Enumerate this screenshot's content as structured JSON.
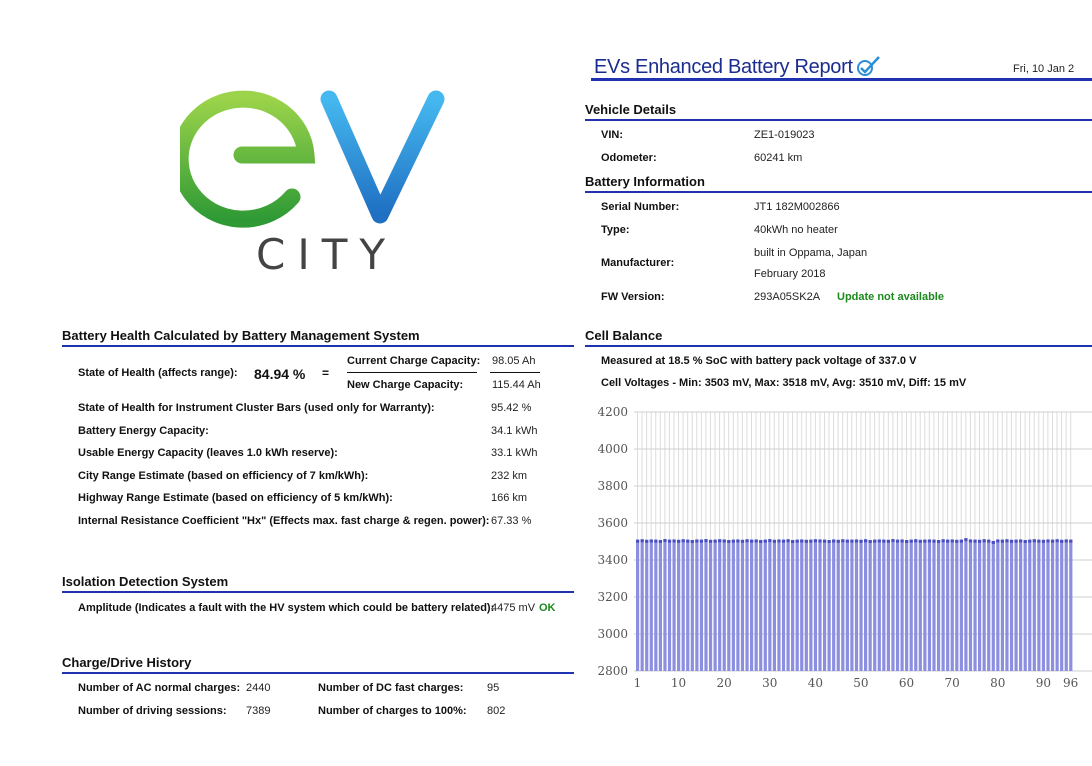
{
  "logo": {
    "city_text": "CITY"
  },
  "report": {
    "title": "EVs Enhanced Battery Report",
    "date": "Fri, 10 Jan 2"
  },
  "vehicle": {
    "section_title": "Vehicle Details",
    "vin_label": "VIN:",
    "vin": "ZE1-019023",
    "odometer_label": "Odometer:",
    "odometer": "60241 km"
  },
  "battery": {
    "section_title": "Battery Information",
    "serial_label": "Serial Number:",
    "serial": "JT1 182M002866",
    "type_label": "Type:",
    "type": "40kWh no heater",
    "manufacturer_label": "Manufacturer:",
    "manufacturer_line1": "built in Oppama, Japan",
    "manufacturer_line2": "February 2018",
    "fw_label": "FW Version:",
    "fw": "293A05SK2A",
    "fw_status": "Update not available"
  },
  "health": {
    "section_title": "Battery Health Calculated by Battery Management System",
    "soh_label": "State of Health (affects range):",
    "soh_value": "84.94 %",
    "equals": "=",
    "current_cap_label": "Current Charge Capacity:",
    "current_cap": "98.05 Ah",
    "new_cap_label": "New Charge Capacity:",
    "new_cap": "115.44 Ah",
    "rows": [
      {
        "label": "State of Health for Instrument Cluster Bars (used only for Warranty):",
        "value": "95.42 %"
      },
      {
        "label": "Battery Energy Capacity:",
        "value": "34.1 kWh"
      },
      {
        "label": "Usable Energy Capacity (leaves 1.0 kWh reserve):",
        "value": "33.1 kWh"
      },
      {
        "label": "City Range Estimate (based on efficiency of 7 km/kWh):",
        "value": "232 km"
      },
      {
        "label": "Highway Range Estimate (based on efficiency of 5 km/kWh):",
        "value": "166 km"
      },
      {
        "label": "Internal Resistance Coefficient \"Hx\" (Effects max. fast charge & regen. power):",
        "value": "67.33 %"
      }
    ]
  },
  "isolation": {
    "section_title": "Isolation Detection System",
    "amplitude_label": "Amplitude (Indicates a fault with the HV system which could be battery related):",
    "amplitude": "4475 mV",
    "status": "OK"
  },
  "history": {
    "section_title": "Charge/Drive History",
    "ac_label": "Number of AC normal charges:",
    "ac": "2440",
    "dc_label": "Number of DC fast charges:",
    "dc": "95",
    "sessions_label": "Number of driving sessions:",
    "sessions": "7389",
    "full_label": "Number of charges to 100%:",
    "full": "802"
  },
  "cell_balance": {
    "section_title": "Cell Balance",
    "measured": "Measured at 18.5 % SoC with battery pack voltage of 337.0 V",
    "voltages": "Cell Voltages - Min: 3503 mV, Max: 3518 mV, Avg: 3510 mV, Diff: 15 mV"
  },
  "colors": {
    "accent": "#1f33b0",
    "ok": "#1c8a1c",
    "bar": "#8c8fe0",
    "bar_edge": "#4a4ec0"
  },
  "chart_data": {
    "type": "bar",
    "title": "",
    "xlabel": "",
    "ylabel": "",
    "ylim": [
      2800,
      4200
    ],
    "yticks": [
      2800,
      3000,
      3200,
      3400,
      3600,
      3800,
      4000,
      4200
    ],
    "xticks": [
      1,
      10,
      20,
      30,
      40,
      50,
      60,
      70,
      80,
      90,
      96
    ],
    "x": [
      1,
      2,
      3,
      4,
      5,
      6,
      7,
      8,
      9,
      10,
      11,
      12,
      13,
      14,
      15,
      16,
      17,
      18,
      19,
      20,
      21,
      22,
      23,
      24,
      25,
      26,
      27,
      28,
      29,
      30,
      31,
      32,
      33,
      34,
      35,
      36,
      37,
      38,
      39,
      40,
      41,
      42,
      43,
      44,
      45,
      46,
      47,
      48,
      49,
      50,
      51,
      52,
      53,
      54,
      55,
      56,
      57,
      58,
      59,
      60,
      61,
      62,
      63,
      64,
      65,
      66,
      67,
      68,
      69,
      70,
      71,
      72,
      73,
      74,
      75,
      76,
      77,
      78,
      79,
      80,
      81,
      82,
      83,
      84,
      85,
      86,
      87,
      88,
      89,
      90,
      91,
      92,
      93,
      94,
      95,
      96
    ],
    "values": [
      3510,
      3512,
      3509,
      3511,
      3510,
      3508,
      3513,
      3510,
      3511,
      3509,
      3512,
      3510,
      3508,
      3511,
      3510,
      3513,
      3509,
      3510,
      3512,
      3511,
      3508,
      3510,
      3511,
      3509,
      3512,
      3510,
      3511,
      3508,
      3510,
      3513,
      3509,
      3511,
      3510,
      3512,
      3508,
      3510,
      3511,
      3509,
      3510,
      3512,
      3511,
      3510,
      3508,
      3511,
      3509,
      3512,
      3510,
      3510,
      3511,
      3509,
      3512,
      3508,
      3510,
      3511,
      3510,
      3509,
      3513,
      3510,
      3511,
      3508,
      3510,
      3512,
      3509,
      3510,
      3511,
      3510,
      3508,
      3512,
      3510,
      3511,
      3509,
      3510,
      3518,
      3511,
      3510,
      3509,
      3512,
      3510,
      3503,
      3511,
      3510,
      3512,
      3509,
      3510,
      3511,
      3508,
      3510,
      3512,
      3510,
      3509,
      3511,
      3510,
      3512,
      3509,
      3511,
      3510
    ],
    "grid": true
  }
}
